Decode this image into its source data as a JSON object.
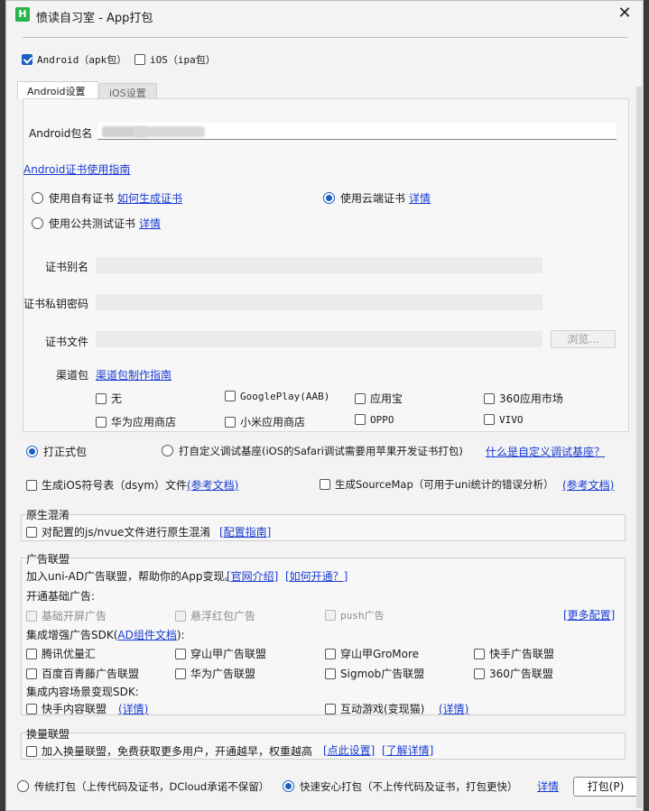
{
  "window": {
    "title": "愤读自习室 - App打包",
    "icon_letter": "H"
  },
  "platforms": {
    "android": "Android（apk包）",
    "ios": "iOS（ipa包）"
  },
  "tabs": {
    "android": "Android设置",
    "ios": "iOS设置"
  },
  "android": {
    "package_label": "Android包名",
    "cert_guide_link": "Android证书使用指南",
    "own_cert": "使用自有证书",
    "how_gen_cert": "如何生成证书",
    "cloud_cert": "使用云端证书",
    "cloud_detail": "详情",
    "public_cert": "使用公共测试证书",
    "public_detail": "详情",
    "alias_label": "证书别名",
    "key_password_label": "证书私钥密码",
    "cert_file_label": "证书文件",
    "browse": "浏览...",
    "channel_label": "渠道包",
    "channel_guide": "渠道包制作指南",
    "channels": [
      "无",
      "GooglePlay(AAB)",
      "应用宝",
      "360应用市场",
      "华为应用商店",
      "小米应用商店",
      "OPPO",
      "VIVO"
    ]
  },
  "build_type": {
    "release": "打正式包",
    "custom_base": "打自定义调试基座(iOS的Safari调试需要用苹果开发证书打包)",
    "what_is_base": "什么是自定义调试基座？"
  },
  "options": {
    "dsym": "生成iOS符号表（dsym）文件",
    "dsym_doc": "(参考文档)",
    "sourcemap": "生成SourceMap（可用于uni统计的错误分析）",
    "sourcemap_doc": "(参考文档)"
  },
  "obfuscate": {
    "title": "原生混淆",
    "label": "对配置的js/nvue文件进行原生混淆",
    "guide": "[配置指南]"
  },
  "ads": {
    "title": "广告联盟",
    "intro": "加入uni-AD广告联盟，帮助你的App变现。",
    "official": "[官网介绍]",
    "how_to": "[如何开通？]",
    "basic_title": "开通基础广告:",
    "basic": [
      "基础开屏广告",
      "悬浮红包广告",
      "push广告"
    ],
    "more_config": "[更多配置]",
    "sdk_title_prefix": "集成增强广告SDK(",
    "sdk_doc": "AD组件文档",
    "sdk_title_suffix": "):",
    "sdk": [
      "腾讯优量汇",
      "穿山甲广告联盟",
      "穿山甲GroMore",
      "快手广告联盟",
      "百度百青藤广告联盟",
      "华为广告联盟",
      "Sigmob广告联盟",
      "360广告联盟"
    ],
    "content_title": "集成内容场景变现SDK:",
    "kuaishou_content": "快手内容联盟",
    "kuaishou_detail": "(详情)",
    "game": "互动游戏(变现猫)",
    "game_detail": "(详情)"
  },
  "exchange": {
    "title": "换量联盟",
    "label": "加入换量联盟，免费获取更多用户，开通越早，权重越高",
    "settings": "[点此设置]",
    "learn": "[了解详情]"
  },
  "footer": {
    "traditional": "传统打包（上传代码及证书，DCloud承诺不保留）",
    "fast": "快速安心打包（不上传代码及证书，打包更快）",
    "detail": "详情",
    "pack_button": "打包(P)"
  },
  "accent_color": "#1c5fc4",
  "link_color": "#1a3cd1"
}
